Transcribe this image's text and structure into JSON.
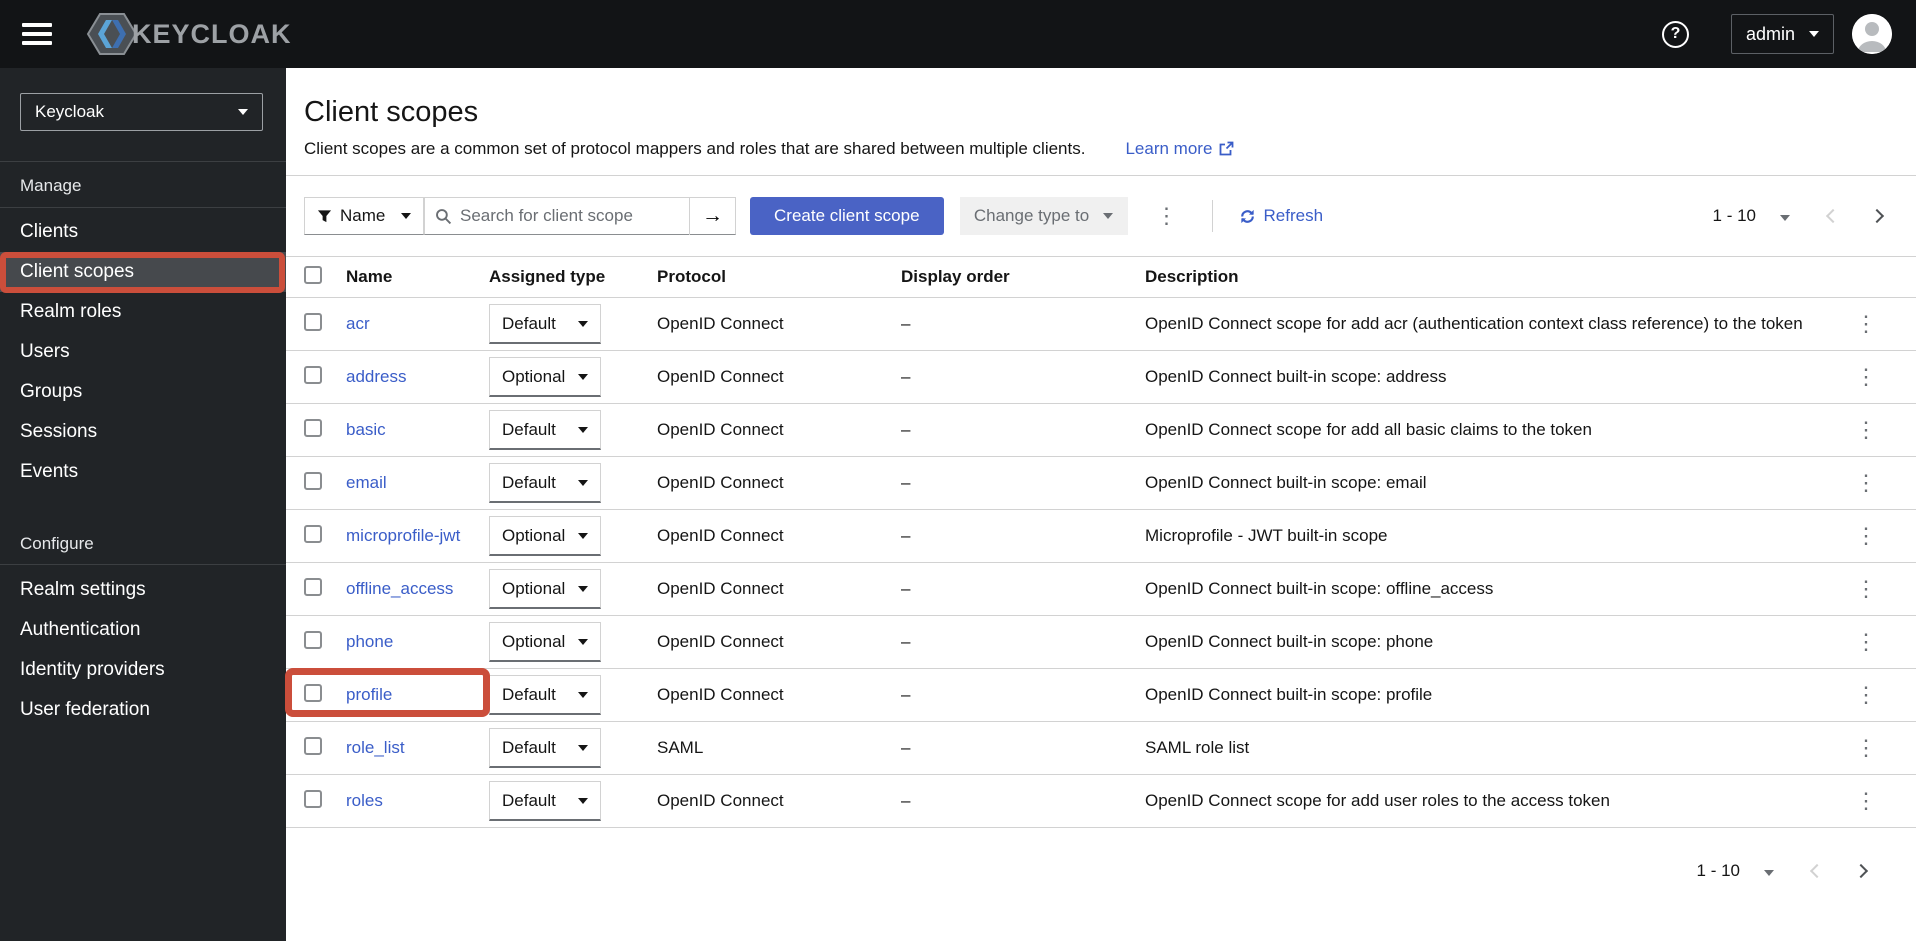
{
  "masthead": {
    "brand_text": "KEYCLOAK",
    "help_glyph": "?",
    "username": "admin"
  },
  "sidebar": {
    "realm": "Keycloak",
    "sections": [
      {
        "title": "Manage",
        "items": [
          {
            "label": "Clients",
            "selected": false
          },
          {
            "label": "Client scopes",
            "selected": true
          },
          {
            "label": "Realm roles",
            "selected": false
          },
          {
            "label": "Users",
            "selected": false
          },
          {
            "label": "Groups",
            "selected": false
          },
          {
            "label": "Sessions",
            "selected": false
          },
          {
            "label": "Events",
            "selected": false
          }
        ]
      },
      {
        "title": "Configure",
        "items": [
          {
            "label": "Realm settings",
            "selected": false
          },
          {
            "label": "Authentication",
            "selected": false
          },
          {
            "label": "Identity providers",
            "selected": false
          },
          {
            "label": "User federation",
            "selected": false
          }
        ]
      }
    ]
  },
  "page": {
    "title": "Client scopes",
    "description": "Client scopes are a common set of protocol mappers and roles that are shared between multiple clients.",
    "learn_more": "Learn more"
  },
  "toolbar": {
    "filter_label": "Name",
    "search_placeholder": "Search for client scope",
    "create_label": "Create client scope",
    "change_type_label": "Change type to",
    "refresh_label": "Refresh"
  },
  "pagination": {
    "range": "1 - 10"
  },
  "table": {
    "columns": [
      "Name",
      "Assigned type",
      "Protocol",
      "Display order",
      "Description"
    ],
    "rows": [
      {
        "name": "acr",
        "assigned_type": "Default",
        "protocol": "OpenID Connect",
        "display_order": "–",
        "description": "OpenID Connect scope for add acr (authentication context class reference) to the token",
        "highlighted": false
      },
      {
        "name": "address",
        "assigned_type": "Optional",
        "protocol": "OpenID Connect",
        "display_order": "–",
        "description": "OpenID Connect built-in scope: address",
        "highlighted": false
      },
      {
        "name": "basic",
        "assigned_type": "Default",
        "protocol": "OpenID Connect",
        "display_order": "–",
        "description": "OpenID Connect scope for add all basic claims to the token",
        "highlighted": false
      },
      {
        "name": "email",
        "assigned_type": "Default",
        "protocol": "OpenID Connect",
        "display_order": "–",
        "description": "OpenID Connect built-in scope: email",
        "highlighted": false
      },
      {
        "name": "microprofile-jwt",
        "assigned_type": "Optional",
        "protocol": "OpenID Connect",
        "display_order": "–",
        "description": "Microprofile - JWT built-in scope",
        "highlighted": false
      },
      {
        "name": "offline_access",
        "assigned_type": "Optional",
        "protocol": "OpenID Connect",
        "display_order": "–",
        "description": "OpenID Connect built-in scope: offline_access",
        "highlighted": false
      },
      {
        "name": "phone",
        "assigned_type": "Optional",
        "protocol": "OpenID Connect",
        "display_order": "–",
        "description": "OpenID Connect built-in scope: phone",
        "highlighted": false
      },
      {
        "name": "profile",
        "assigned_type": "Default",
        "protocol": "OpenID Connect",
        "display_order": "–",
        "description": "OpenID Connect built-in scope: profile",
        "highlighted": true
      },
      {
        "name": "role_list",
        "assigned_type": "Default",
        "protocol": "SAML",
        "display_order": "–",
        "description": "SAML role list",
        "highlighted": false
      },
      {
        "name": "roles",
        "assigned_type": "Default",
        "protocol": "OpenID Connect",
        "display_order": "–",
        "description": "OpenID Connect scope for add user roles to the access token",
        "highlighted": false
      }
    ]
  },
  "icons": {
    "kebab_glyph": "⋮",
    "search_go_glyph": "→"
  },
  "colors": {
    "accent": "#4a63c5",
    "link": "#3a5dc8",
    "annotation": "#cb4e3b",
    "masthead_bg": "#121416",
    "sidebar_bg": "#212427",
    "selected_item_bg": "#46494d"
  }
}
